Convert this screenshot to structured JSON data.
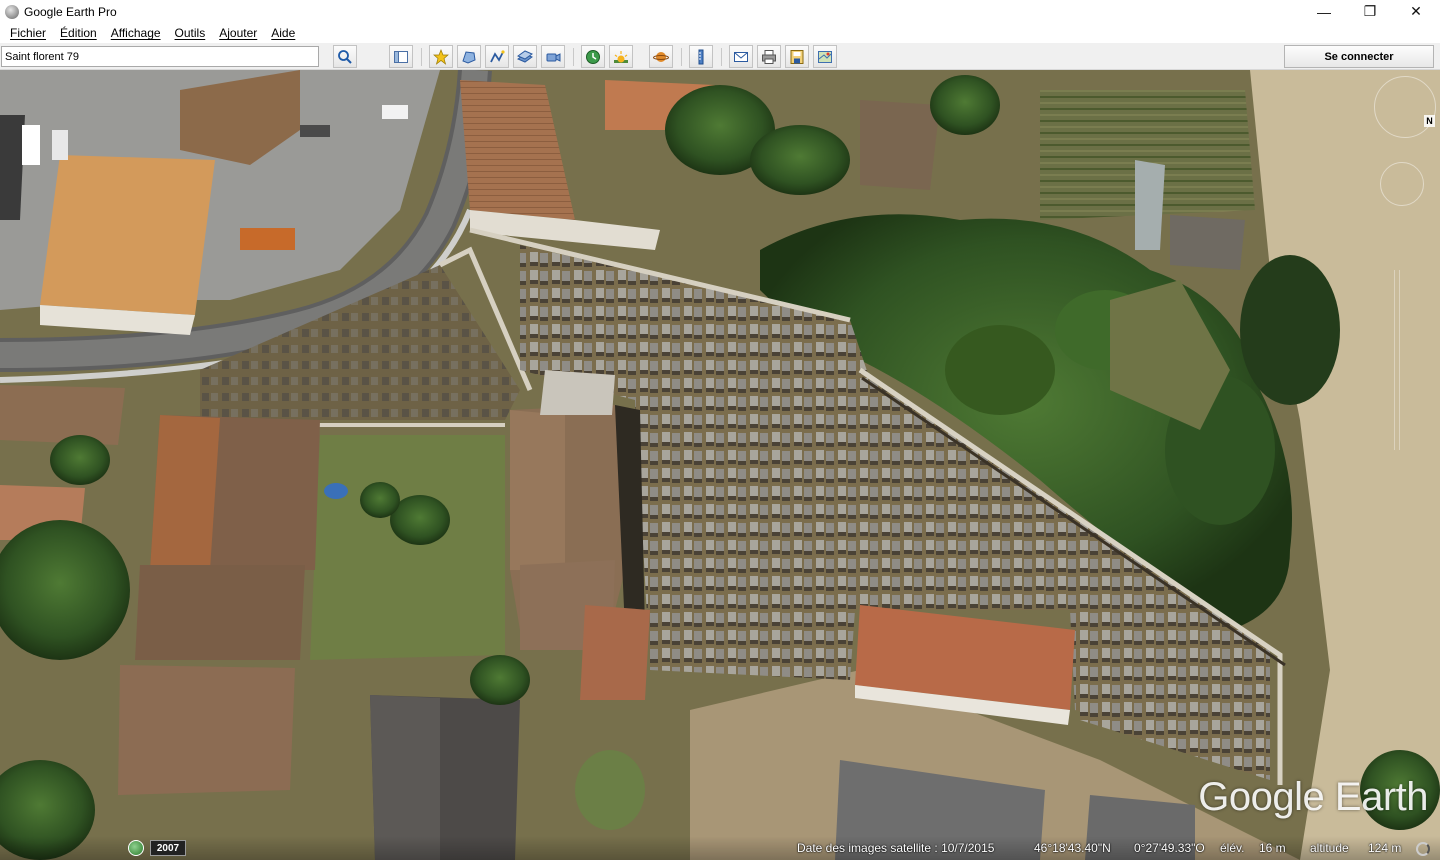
{
  "window": {
    "title": "Google Earth Pro",
    "minimize_label": "—",
    "restore_label": "❐",
    "close_label": "✕"
  },
  "menu": {
    "items": [
      {
        "label": "Fichier"
      },
      {
        "label": "Édition"
      },
      {
        "label": "Affichage"
      },
      {
        "label": "Outils"
      },
      {
        "label": "Ajouter"
      },
      {
        "label": "Aide"
      }
    ]
  },
  "toolbar": {
    "search_value": "Saint florent 79",
    "connect_label": "Se connecter",
    "icons": [
      "search-icon",
      "sidebar-toggle-icon",
      "placemark-icon",
      "polygon-icon",
      "path-icon",
      "image-overlay-icon",
      "record-tour-icon",
      "historical-imagery-icon",
      "sunlight-icon",
      "planets-icon",
      "ruler-icon",
      "email-icon",
      "print-icon",
      "save-image-icon",
      "maps-view-icon"
    ]
  },
  "map": {
    "compass_label": "N",
    "watermark": "Google Earth"
  },
  "status": {
    "year": "2007",
    "imagery_date": "Date des images satellite : 10/7/2015",
    "latitude": "46°18'43.40\"N",
    "longitude": "0°27'49.33\"O",
    "elevation_label": "élév.",
    "elevation_value": "16 m",
    "altitude_label": "altitude",
    "altitude_value": "124 m"
  }
}
